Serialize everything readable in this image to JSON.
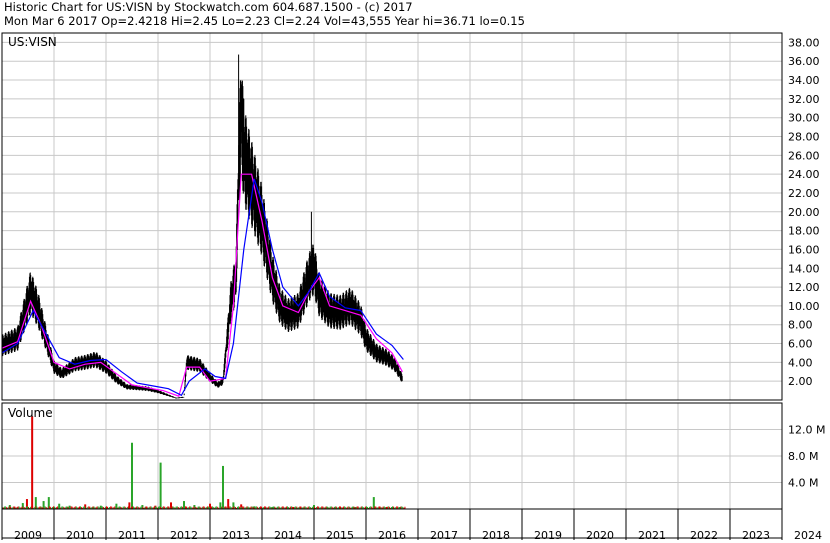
{
  "header": {
    "line1": "Historic Chart for US:VISN by Stockwatch.com 604.687.1500 - (c) 2017",
    "line2": "Mon Mar  6 2017  Op=2.4218  Hi=2.45  Lo=2.23  Cl=2.24  Vol=43,555  Year hi=36.71  lo=0.15"
  },
  "price_panel_label": "US:VISN",
  "volume_panel_label": "Volume",
  "colors": {
    "price_bars": "#000000",
    "ma_short": "#ff00ff",
    "ma_long": "#0000ff",
    "volume_up": "#2aa52a",
    "volume_down": "#dd0000",
    "grid": "#c8c8c8"
  },
  "chart_data": [
    {
      "type": "line",
      "title": "US:VISN",
      "x_ticks": [
        "2009",
        "2010",
        "2011",
        "2012",
        "2013",
        "2014",
        "2015",
        "2016",
        "2017",
        "2018",
        "2019",
        "2020",
        "2021",
        "2022",
        "2023",
        "2024"
      ],
      "y_ticks": [
        "2.00",
        "4.00",
        "6.00",
        "8.00",
        "10.00",
        "12.00",
        "14.00",
        "16.00",
        "18.00",
        "20.00",
        "22.00",
        "24.00",
        "26.00",
        "28.00",
        "30.00",
        "32.00",
        "34.00",
        "36.00",
        "38.00"
      ],
      "ylim": [
        0,
        39
      ],
      "grid": true,
      "series": [
        {
          "kind": "price",
          "x": [
            2009.0,
            2009.3,
            2009.55,
            2009.7,
            2009.9,
            2010.0,
            2010.15,
            2010.4,
            2010.6,
            2010.8,
            2011.0,
            2011.2,
            2011.4,
            2011.6,
            2011.8,
            2012.0,
            2012.2,
            2012.35,
            2012.5,
            2012.55,
            2012.8,
            2013.0,
            2013.15,
            2013.25,
            2013.4,
            2013.5,
            2013.55,
            2013.6,
            2013.65,
            2013.8,
            2014.0,
            2014.2,
            2014.35,
            2014.5,
            2014.7,
            2014.9,
            2015.0,
            2015.1,
            2015.3,
            2015.5,
            2015.7,
            2015.9,
            2016.0,
            2016.2,
            2016.4,
            2016.55,
            2016.7
          ],
          "y": [
            5.8,
            6.5,
            11.5,
            9.5,
            5.5,
            3.5,
            2.8,
            3.8,
            4.0,
            4.3,
            3.5,
            2.2,
            1.4,
            1.3,
            1.2,
            0.9,
            0.5,
            0.2,
            0.3,
            4.0,
            3.7,
            2.4,
            1.6,
            2.0,
            10.5,
            13.0,
            24.0,
            31.0,
            26.0,
            23.0,
            19.0,
            13.0,
            10.0,
            9.0,
            9.5,
            13.0,
            14.0,
            11.0,
            9.5,
            9.3,
            10.0,
            8.5,
            6.5,
            5.0,
            4.5,
            3.8,
            2.24
          ]
        },
        {
          "kind": "ma-short",
          "x": [
            2009.0,
            2009.3,
            2009.55,
            2009.75,
            2010.0,
            2010.3,
            2010.6,
            2010.9,
            2011.2,
            2011.5,
            2011.8,
            2012.1,
            2012.4,
            2012.55,
            2012.8,
            2013.0,
            2013.3,
            2013.45,
            2013.6,
            2013.8,
            2014.0,
            2014.2,
            2014.4,
            2014.7,
            2014.9,
            2015.1,
            2015.3,
            2015.6,
            2015.9,
            2016.2,
            2016.5,
            2016.7
          ],
          "y": [
            5.5,
            6.2,
            10.5,
            8.0,
            4.0,
            3.3,
            3.8,
            4.0,
            2.8,
            1.6,
            1.3,
            1.0,
            0.4,
            3.5,
            3.5,
            2.0,
            2.3,
            10.0,
            24.0,
            24.0,
            19.0,
            13.0,
            10.0,
            9.3,
            11.5,
            13.0,
            10.0,
            9.5,
            9.0,
            6.5,
            5.0,
            3.0
          ]
        },
        {
          "kind": "ma-long",
          "x": [
            2009.0,
            2009.3,
            2009.6,
            2009.85,
            2010.1,
            2010.4,
            2010.7,
            2011.0,
            2011.3,
            2011.6,
            2011.9,
            2012.2,
            2012.45,
            2012.6,
            2012.9,
            2013.1,
            2013.3,
            2013.45,
            2013.65,
            2013.85,
            2014.0,
            2014.2,
            2014.4,
            2014.7,
            2014.9,
            2015.1,
            2015.3,
            2015.6,
            2015.9,
            2016.2,
            2016.5,
            2016.72
          ],
          "y": [
            5.0,
            6.0,
            9.5,
            7.0,
            4.5,
            3.8,
            4.2,
            4.3,
            3.0,
            1.8,
            1.5,
            1.2,
            0.5,
            2.0,
            3.3,
            2.5,
            2.3,
            6.0,
            16.0,
            23.5,
            21.0,
            16.0,
            12.0,
            10.0,
            11.5,
            13.5,
            11.0,
            9.8,
            9.5,
            7.0,
            5.8,
            4.3
          ]
        }
      ]
    },
    {
      "type": "bar",
      "title": "Volume",
      "y_ticks": [
        "4.0 M",
        "8.0 M",
        "12.0 M"
      ],
      "ylim": [
        0,
        16
      ],
      "bars_millions": [
        {
          "x": 2009.15,
          "v": 0.6,
          "up": true
        },
        {
          "x": 2009.4,
          "v": 0.9,
          "up": true
        },
        {
          "x": 2009.48,
          "v": 1.5,
          "up": false
        },
        {
          "x": 2009.58,
          "v": 14.0,
          "up": false
        },
        {
          "x": 2009.65,
          "v": 1.8,
          "up": true
        },
        {
          "x": 2009.8,
          "v": 1.2,
          "up": true
        },
        {
          "x": 2009.9,
          "v": 1.8,
          "up": true
        },
        {
          "x": 2010.1,
          "v": 0.8,
          "up": true
        },
        {
          "x": 2010.3,
          "v": 0.5,
          "up": true
        },
        {
          "x": 2010.6,
          "v": 0.7,
          "up": false
        },
        {
          "x": 2010.9,
          "v": 0.5,
          "up": true
        },
        {
          "x": 2011.2,
          "v": 0.8,
          "up": true
        },
        {
          "x": 2011.45,
          "v": 1.0,
          "up": false
        },
        {
          "x": 2011.5,
          "v": 10.0,
          "up": true
        },
        {
          "x": 2011.7,
          "v": 0.6,
          "up": true
        },
        {
          "x": 2011.95,
          "v": 0.5,
          "up": false
        },
        {
          "x": 2012.05,
          "v": 7.0,
          "up": true
        },
        {
          "x": 2012.25,
          "v": 1.0,
          "up": false
        },
        {
          "x": 2012.5,
          "v": 1.2,
          "up": true
        },
        {
          "x": 2012.7,
          "v": 0.6,
          "up": true
        },
        {
          "x": 2013.0,
          "v": 0.8,
          "up": false
        },
        {
          "x": 2013.2,
          "v": 1.0,
          "up": true
        },
        {
          "x": 2013.25,
          "v": 6.5,
          "up": true
        },
        {
          "x": 2013.35,
          "v": 1.5,
          "up": false
        },
        {
          "x": 2013.45,
          "v": 1.0,
          "up": true
        },
        {
          "x": 2013.6,
          "v": 0.7,
          "up": false
        },
        {
          "x": 2013.85,
          "v": 0.4,
          "up": true
        },
        {
          "x": 2014.2,
          "v": 0.3,
          "up": true
        },
        {
          "x": 2014.6,
          "v": 0.3,
          "up": false
        },
        {
          "x": 2015.0,
          "v": 0.6,
          "up": true
        },
        {
          "x": 2015.4,
          "v": 0.3,
          "up": false
        },
        {
          "x": 2015.8,
          "v": 0.3,
          "up": true
        },
        {
          "x": 2016.15,
          "v": 1.8,
          "up": true
        },
        {
          "x": 2016.4,
          "v": 0.3,
          "up": false
        },
        {
          "x": 2016.65,
          "v": 0.3,
          "up": true
        }
      ]
    }
  ]
}
